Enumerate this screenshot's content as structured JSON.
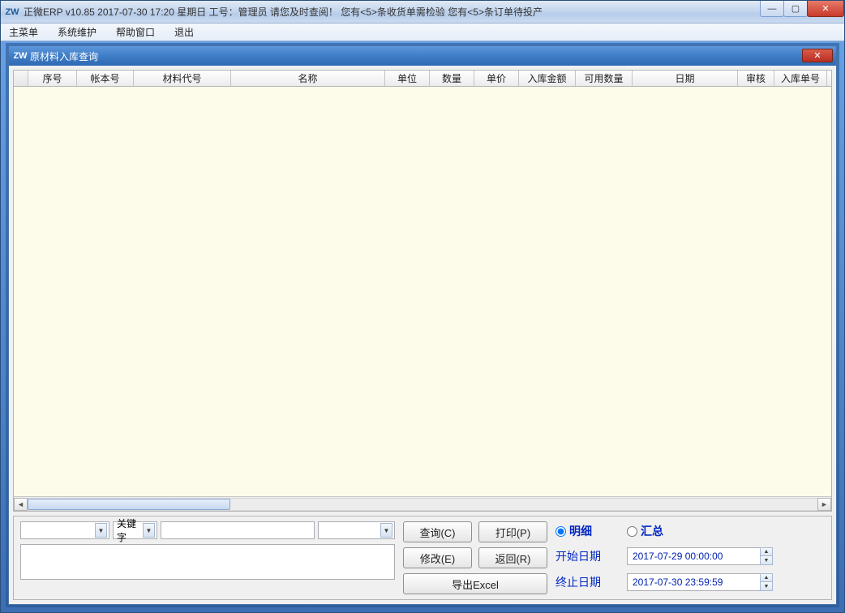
{
  "app": {
    "logo_text": "ZW",
    "title": "正微ERP v10.85    2017-07-30 17:20 星期日    工号：管理员   请您及时查阅！ 您有<5>条收货单需检验 您有<5>条订单待投产"
  },
  "menubar": [
    "主菜单",
    "系统维护",
    "帮助窗口",
    "退出"
  ],
  "child": {
    "logo_text": "ZW",
    "title": "原材料入库查询"
  },
  "columns": [
    {
      "label": "序号",
      "width": 60
    },
    {
      "label": "帐本号",
      "width": 70
    },
    {
      "label": "材料代号",
      "width": 120
    },
    {
      "label": "名称",
      "width": 190
    },
    {
      "label": "单位",
      "width": 55
    },
    {
      "label": "数量",
      "width": 55
    },
    {
      "label": "单价",
      "width": 55
    },
    {
      "label": "入库金额",
      "width": 70
    },
    {
      "label": "可用数量",
      "width": 70
    },
    {
      "label": "日期",
      "width": 130
    },
    {
      "label": "审核",
      "width": 45
    },
    {
      "label": "入库单号",
      "width": 65
    }
  ],
  "bottom": {
    "keyword_label": "关键字",
    "buttons": {
      "query": "查询(C)",
      "print": "打印(P)",
      "edit": "修改(E)",
      "back": "返回(R)",
      "export": "导出Excel"
    },
    "radio_detail": "明细",
    "radio_summary": "汇总",
    "start_label": "开始日期",
    "end_label": "终止日期",
    "start_value": "2017-07-29 00:00:00",
    "end_value": "2017-07-30 23:59:59"
  }
}
